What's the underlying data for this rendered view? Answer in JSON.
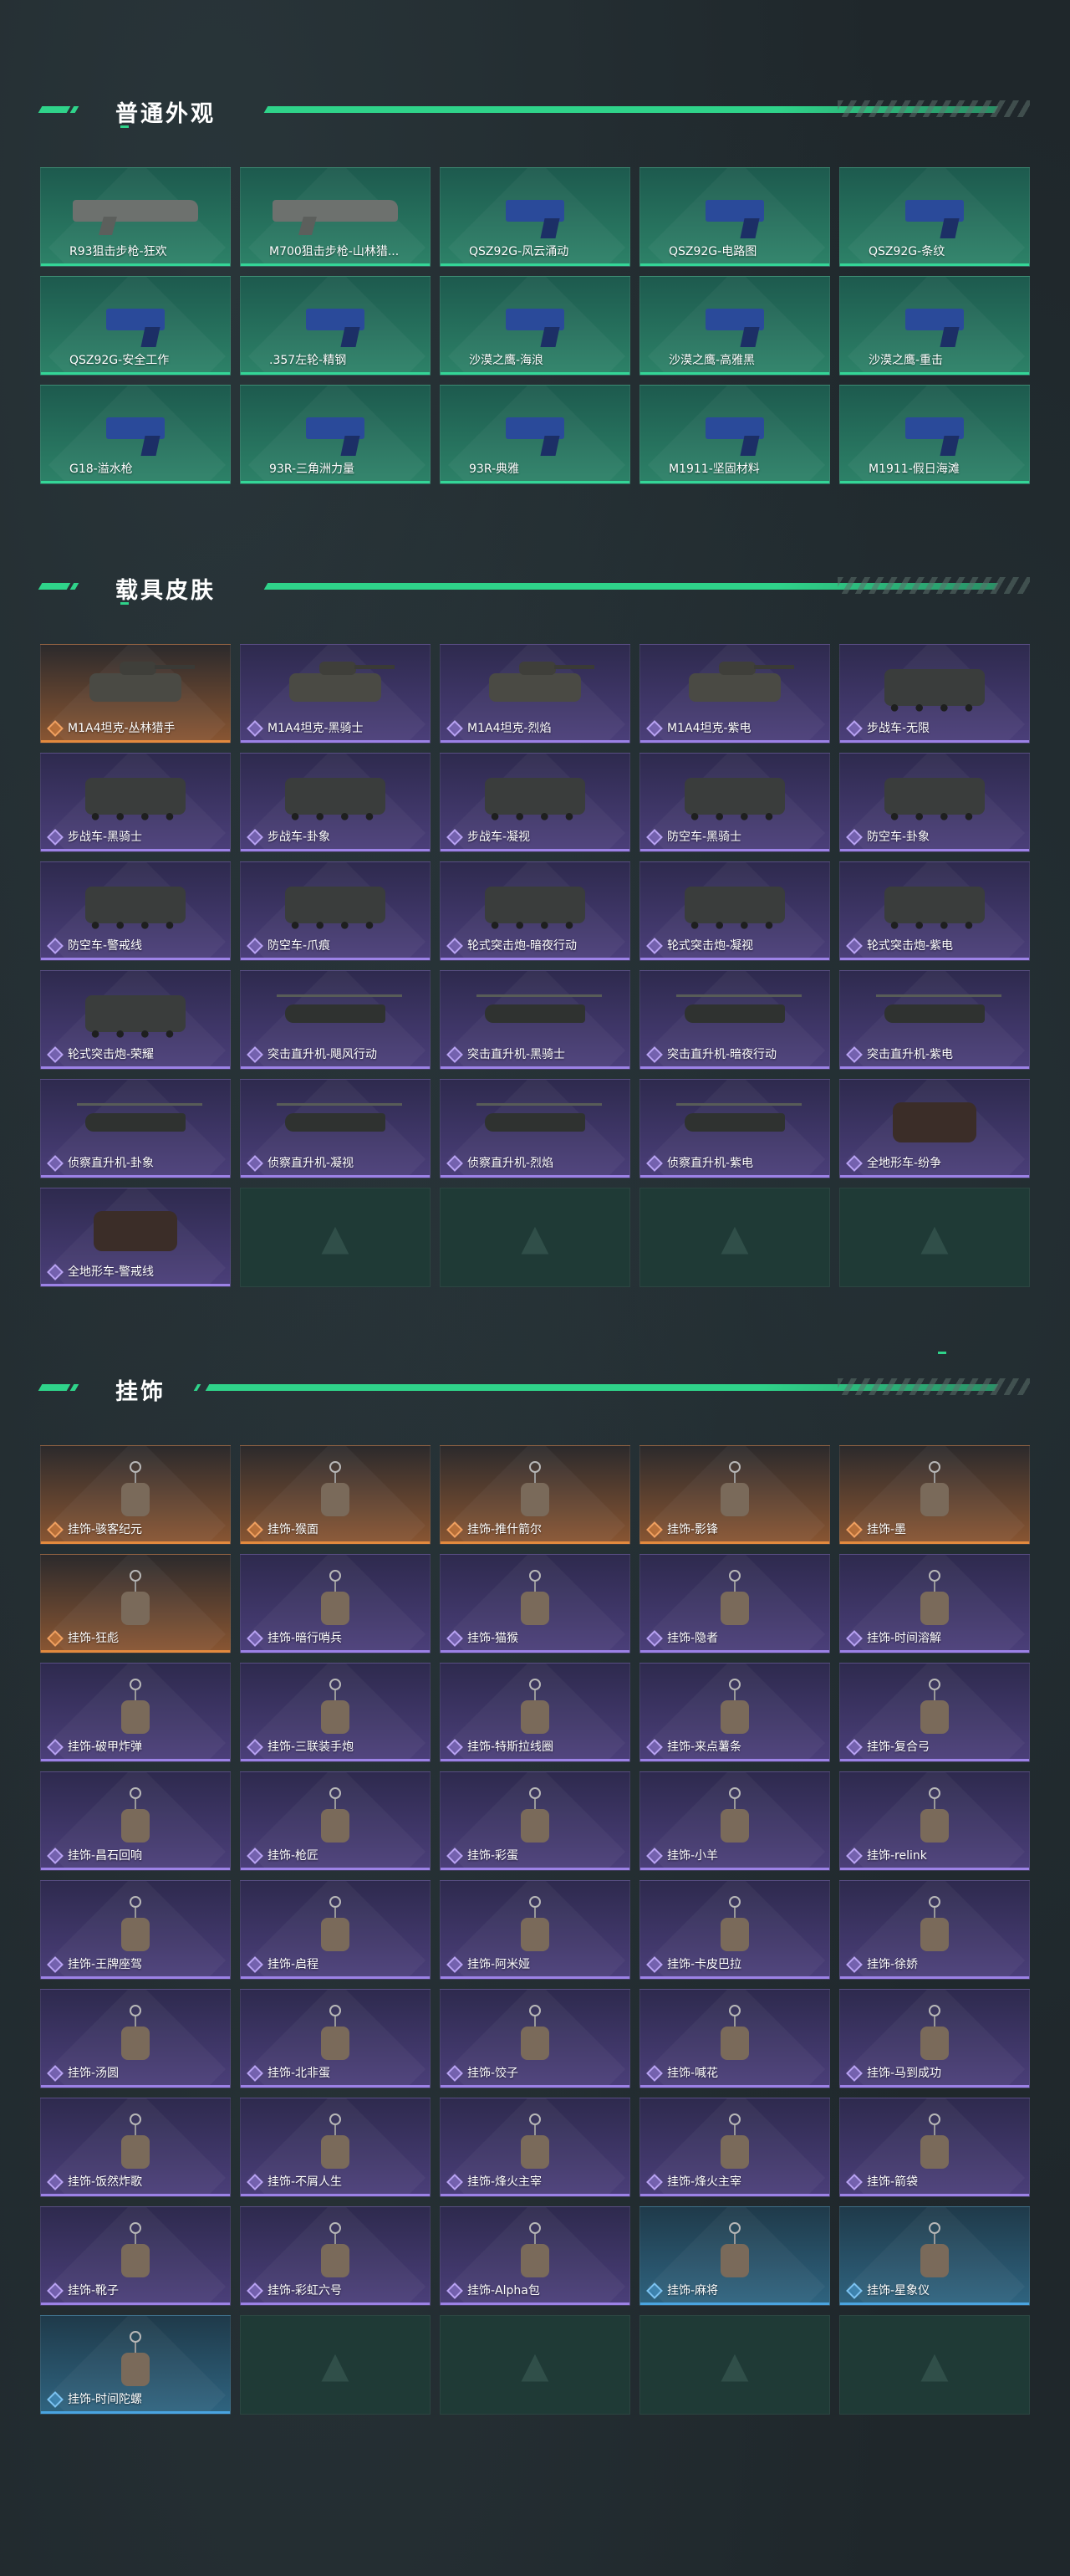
{
  "sections": {
    "skins": {
      "title": "普通外观",
      "items": [
        {
          "label": "R93狙击步枪-狂欢",
          "type": "gun"
        },
        {
          "label": "M700狙击步枪-山林猎...",
          "type": "gun"
        },
        {
          "label": "QSZ92G-风云涌动",
          "type": "pistol"
        },
        {
          "label": "QSZ92G-电路图",
          "type": "pistol"
        },
        {
          "label": "QSZ92G-条纹",
          "type": "pistol"
        },
        {
          "label": "QSZ92G-安全工作",
          "type": "pistol"
        },
        {
          "label": ".357左轮-精钢",
          "type": "pistol"
        },
        {
          "label": "沙漠之鹰-海浪",
          "type": "pistol"
        },
        {
          "label": "沙漠之鹰-高雅黑",
          "type": "pistol"
        },
        {
          "label": "沙漠之鹰-重击",
          "type": "pistol"
        },
        {
          "label": "G18-溢水枪",
          "type": "pistol"
        },
        {
          "label": "93R-三角洲力量",
          "type": "pistol"
        },
        {
          "label": "93R-典雅",
          "type": "pistol"
        },
        {
          "label": "M1911-坚固材料",
          "type": "pistol"
        },
        {
          "label": "M1911-假日海滩",
          "type": "pistol"
        }
      ]
    },
    "vehicles": {
      "title": "载具皮肤",
      "items": [
        {
          "label": "M1A4坦克-丛林猎手",
          "rarity": "orange",
          "type": "tank"
        },
        {
          "label": "M1A4坦克-黑骑士",
          "rarity": "purple",
          "type": "tank"
        },
        {
          "label": "M1A4坦克-烈焰",
          "rarity": "purple",
          "type": "tank"
        },
        {
          "label": "M1A4坦克-紫电",
          "rarity": "purple",
          "type": "tank"
        },
        {
          "label": "步战车-无限",
          "rarity": "purple",
          "type": "apc"
        },
        {
          "label": "步战车-黑骑士",
          "rarity": "purple",
          "type": "apc"
        },
        {
          "label": "步战车-卦象",
          "rarity": "purple",
          "type": "apc"
        },
        {
          "label": "步战车-凝视",
          "rarity": "purple",
          "type": "apc"
        },
        {
          "label": "防空车-黑骑士",
          "rarity": "purple",
          "type": "apc"
        },
        {
          "label": "防空车-卦象",
          "rarity": "purple",
          "type": "apc"
        },
        {
          "label": "防空车-警戒线",
          "rarity": "purple",
          "type": "apc"
        },
        {
          "label": "防空车-爪痕",
          "rarity": "purple",
          "type": "apc"
        },
        {
          "label": "轮式突击炮-暗夜行动",
          "rarity": "purple",
          "type": "apc"
        },
        {
          "label": "轮式突击炮-凝视",
          "rarity": "purple",
          "type": "apc"
        },
        {
          "label": "轮式突击炮-紫电",
          "rarity": "purple",
          "type": "apc"
        },
        {
          "label": "轮式突击炮-荣耀",
          "rarity": "purple",
          "type": "apc"
        },
        {
          "label": "突击直升机-飓风行动",
          "rarity": "purple",
          "type": "heli"
        },
        {
          "label": "突击直升机-黑骑士",
          "rarity": "purple",
          "type": "heli"
        },
        {
          "label": "突击直升机-暗夜行动",
          "rarity": "purple",
          "type": "heli"
        },
        {
          "label": "突击直升机-紫电",
          "rarity": "purple",
          "type": "heli"
        },
        {
          "label": "侦察直升机-卦象",
          "rarity": "purple",
          "type": "heli"
        },
        {
          "label": "侦察直升机-凝视",
          "rarity": "purple",
          "type": "heli"
        },
        {
          "label": "侦察直升机-烈焰",
          "rarity": "purple",
          "type": "heli"
        },
        {
          "label": "侦察直升机-紫电",
          "rarity": "purple",
          "type": "heli"
        },
        {
          "label": "全地形车-纷争",
          "rarity": "purple",
          "type": "atv"
        },
        {
          "label": "全地形车-警戒线",
          "rarity": "purple",
          "type": "atv"
        }
      ]
    },
    "charms": {
      "title": "挂饰",
      "items": [
        {
          "label": "挂饰-骇客纪元",
          "rarity": "orange"
        },
        {
          "label": "挂饰-猴面",
          "rarity": "orange"
        },
        {
          "label": "挂饰-推什箭尔",
          "rarity": "orange"
        },
        {
          "label": "挂饰-影锋",
          "rarity": "orange"
        },
        {
          "label": "挂饰-墨",
          "rarity": "orange"
        },
        {
          "label": "挂饰-狂彪",
          "rarity": "orange"
        },
        {
          "label": "挂饰-暗行哨兵",
          "rarity": "purple"
        },
        {
          "label": "挂饰-猫猴",
          "rarity": "purple"
        },
        {
          "label": "挂饰-隐者",
          "rarity": "purple"
        },
        {
          "label": "挂饰-时间溶解",
          "rarity": "purple"
        },
        {
          "label": "挂饰-破甲炸弹",
          "rarity": "purple"
        },
        {
          "label": "挂饰-三联装手炮",
          "rarity": "purple"
        },
        {
          "label": "挂饰-特斯拉线圈",
          "rarity": "purple"
        },
        {
          "label": "挂饰-来点薯条",
          "rarity": "purple"
        },
        {
          "label": "挂饰-复合弓",
          "rarity": "purple"
        },
        {
          "label": "挂饰-昌石回响",
          "rarity": "purple"
        },
        {
          "label": "挂饰-枪匠",
          "rarity": "purple"
        },
        {
          "label": "挂饰-彩蛋",
          "rarity": "purple"
        },
        {
          "label": "挂饰-小羊",
          "rarity": "purple"
        },
        {
          "label": "挂饰-relink",
          "rarity": "purple"
        },
        {
          "label": "挂饰-王牌座驾",
          "rarity": "purple"
        },
        {
          "label": "挂饰-启程",
          "rarity": "purple"
        },
        {
          "label": "挂饰-阿米娅",
          "rarity": "purple"
        },
        {
          "label": "挂饰-卡皮巴拉",
          "rarity": "purple"
        },
        {
          "label": "挂饰-徐娇",
          "rarity": "purple"
        },
        {
          "label": "挂饰-汤圆",
          "rarity": "purple"
        },
        {
          "label": "挂饰-北非蛋",
          "rarity": "purple"
        },
        {
          "label": "挂饰-饺子",
          "rarity": "purple"
        },
        {
          "label": "挂饰-喊花",
          "rarity": "purple"
        },
        {
          "label": "挂饰-马到成功",
          "rarity": "purple"
        },
        {
          "label": "挂饰-饭然炸歌",
          "rarity": "purple"
        },
        {
          "label": "挂饰-不屑人生",
          "rarity": "purple"
        },
        {
          "label": "挂饰-烽火主宰",
          "rarity": "purple"
        },
        {
          "label": "挂饰-烽火主宰",
          "rarity": "purple"
        },
        {
          "label": "挂饰-箭袋",
          "rarity": "purple"
        },
        {
          "label": "挂饰-靴子",
          "rarity": "purple"
        },
        {
          "label": "挂饰-彩虹六号",
          "rarity": "purple"
        },
        {
          "label": "挂饰-Alpha包",
          "rarity": "purple"
        },
        {
          "label": "挂饰-麻将",
          "rarity": "blue"
        },
        {
          "label": "挂饰-星象仪",
          "rarity": "blue"
        },
        {
          "label": "挂饰-时间陀螺",
          "rarity": "blue"
        }
      ]
    }
  },
  "colors": {
    "accent": "#2fd38a",
    "gun_card": "#2d8268",
    "purple_card": "#4b3f7a",
    "orange_card": "#8a5632",
    "blue_card": "#2f6480"
  },
  "empty_slot_icon": "logo-watermark-icon"
}
